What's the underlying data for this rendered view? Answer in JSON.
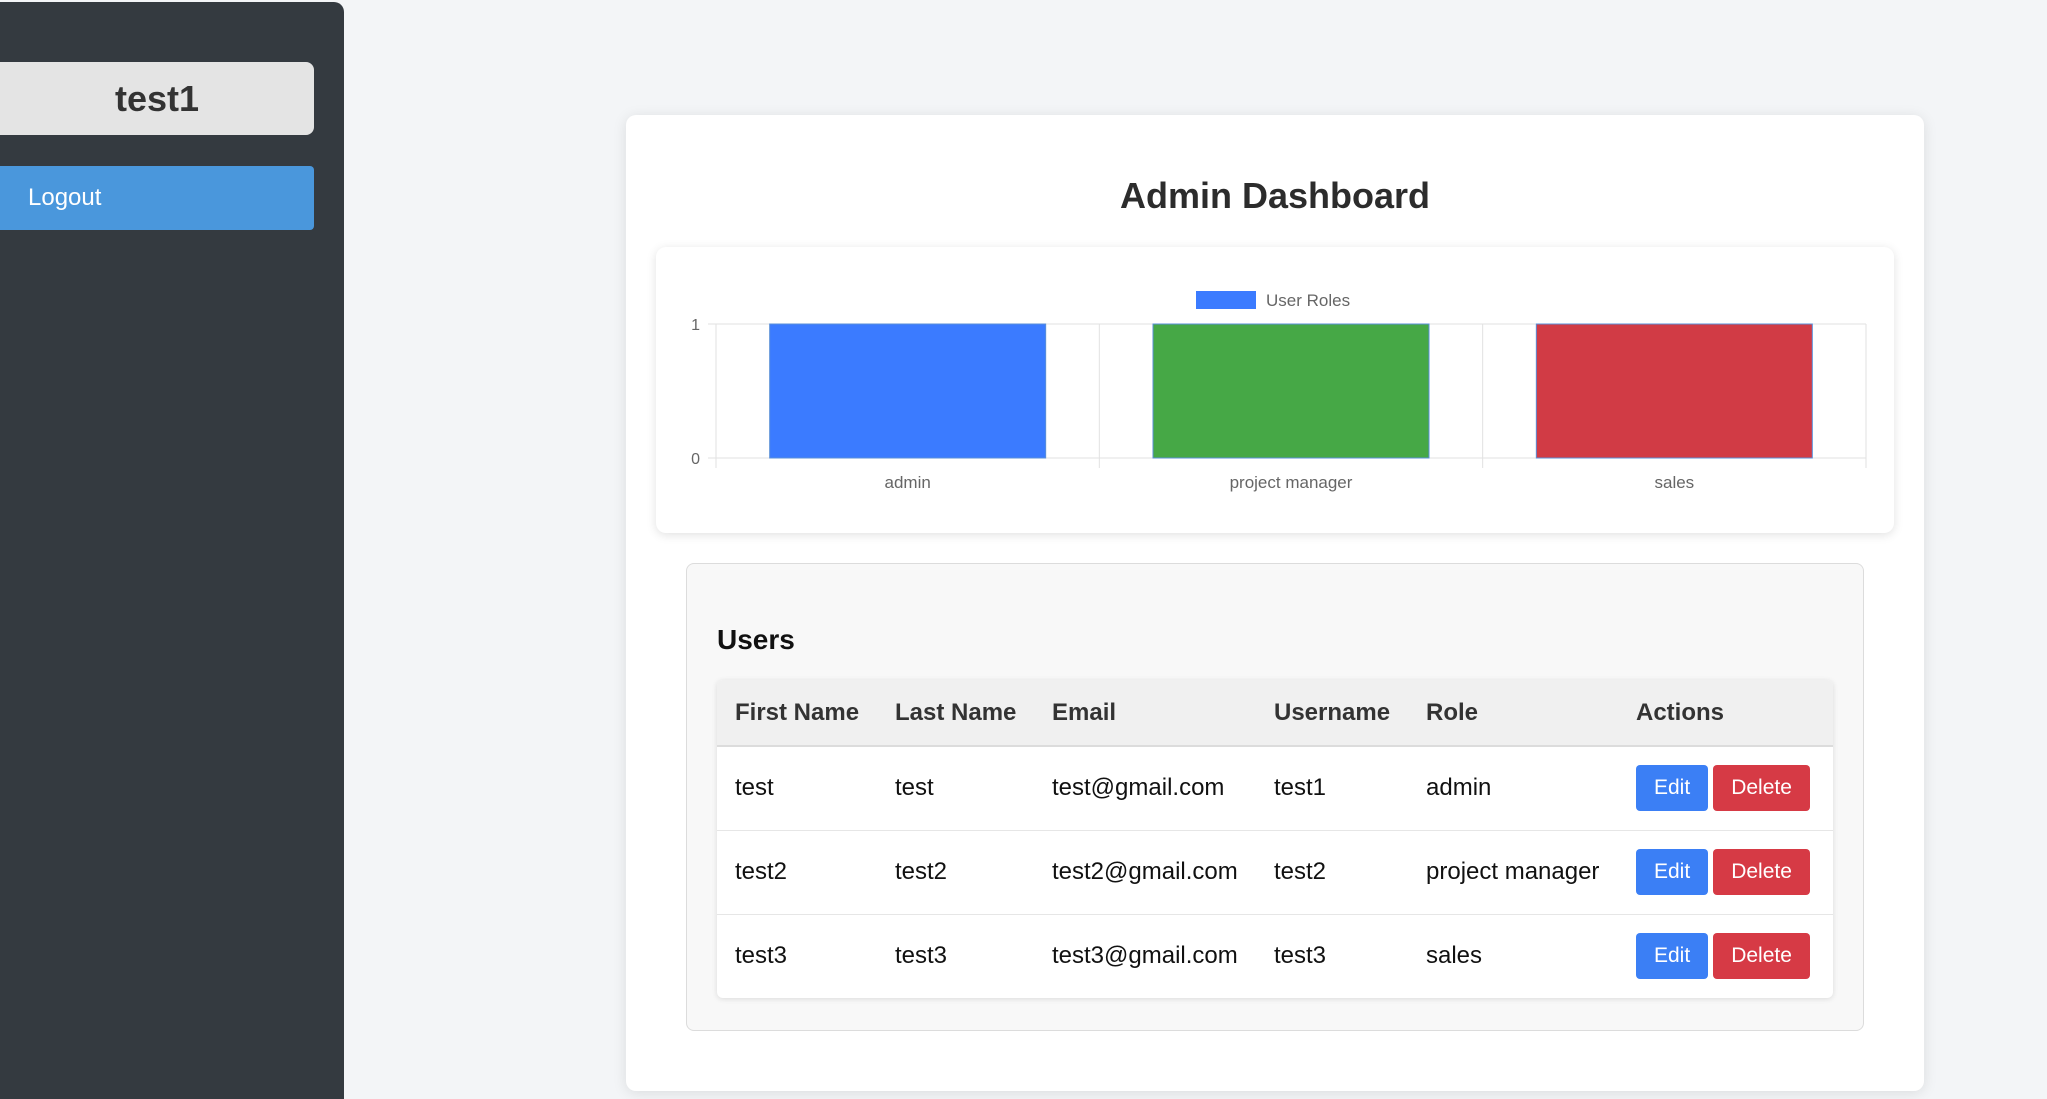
{
  "sidebar": {
    "username": "test1",
    "logout_label": "Logout"
  },
  "main": {
    "title": "Admin Dashboard"
  },
  "chart_data": {
    "type": "bar",
    "categories": [
      "admin",
      "project manager",
      "sales"
    ],
    "series": [
      {
        "name": "User Roles",
        "values": [
          1,
          1,
          1
        ],
        "colors": [
          "#3b7bff",
          "#46a846",
          "#d13b45"
        ]
      }
    ],
    "ylim": [
      0,
      1
    ],
    "yticks": [
      "0",
      "1"
    ],
    "legend": "top-center",
    "grid": true
  },
  "users": {
    "title": "Users",
    "columns": [
      "First Name",
      "Last Name",
      "Email",
      "Username",
      "Role",
      "Actions"
    ],
    "rows": [
      [
        "test",
        "test",
        "test@gmail.com",
        "test1",
        "admin"
      ],
      [
        "test2",
        "test2",
        "test2@gmail.com",
        "test2",
        "project manager"
      ],
      [
        "test3",
        "test3",
        "test3@gmail.com",
        "test3",
        "sales"
      ]
    ],
    "edit_label": "Edit",
    "delete_label": "Delete"
  },
  "colors": {
    "sidebar_bg": "#343a40",
    "logout_bg": "#4a97dc",
    "edit_bg": "#3b7ff5",
    "delete_bg": "#d63a45"
  }
}
